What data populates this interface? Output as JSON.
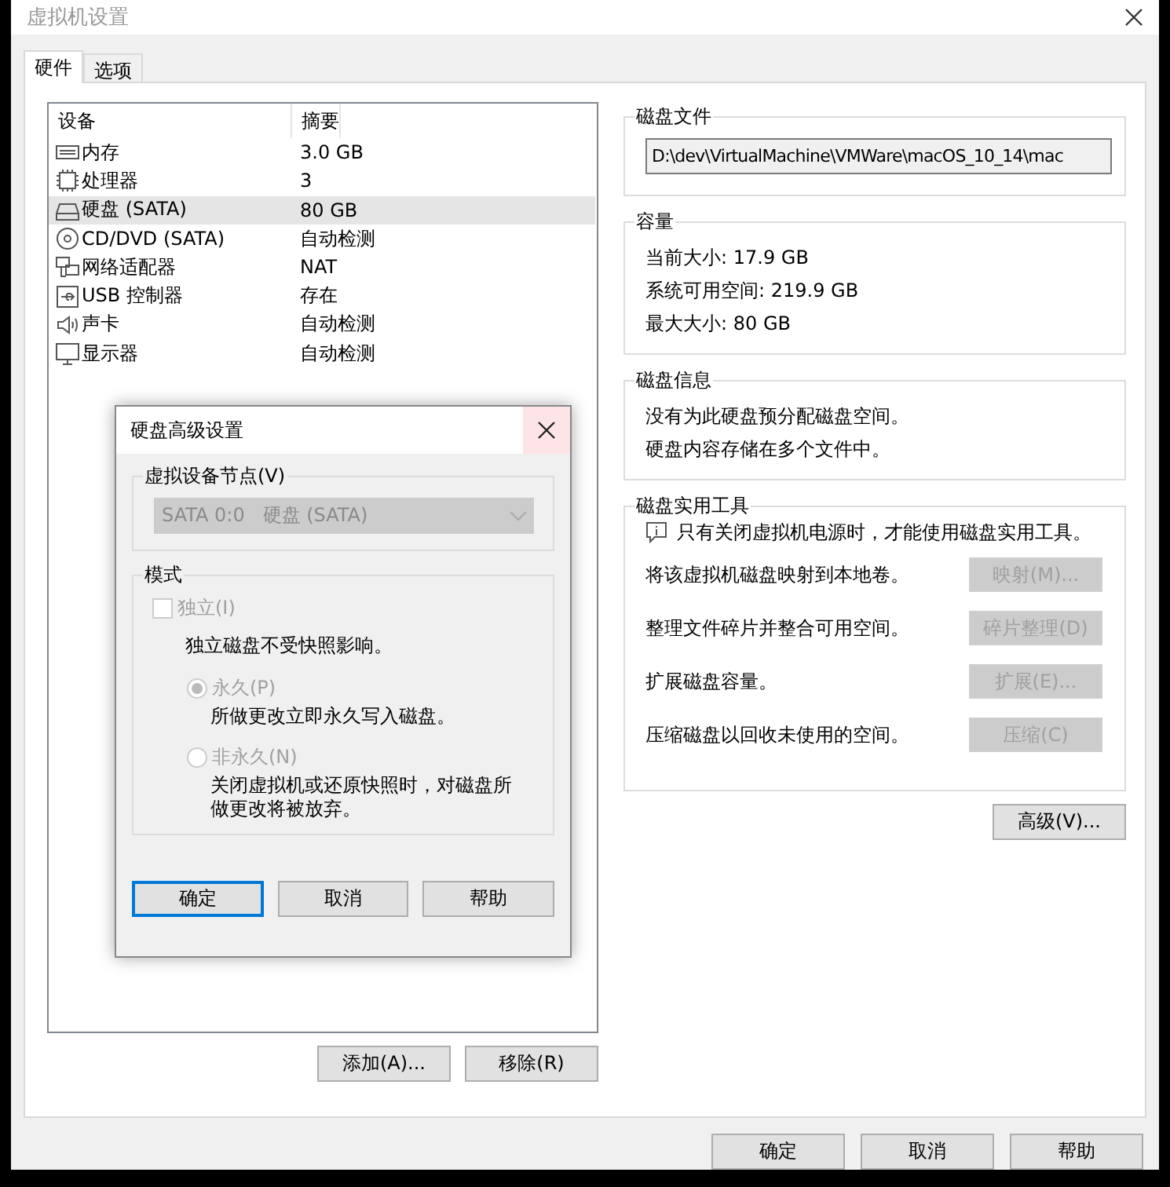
{
  "window": {
    "title": "虚拟机设置"
  },
  "tabs": [
    {
      "label": "硬件",
      "selected": true
    },
    {
      "label": "选项",
      "selected": false
    }
  ],
  "devices": {
    "columns": [
      "设备",
      "摘要"
    ],
    "rows": [
      {
        "kind": "memory",
        "device": "内存",
        "summary": "3.0 GB",
        "selected": false
      },
      {
        "kind": "cpu",
        "device": "处理器",
        "summary": "3",
        "selected": false
      },
      {
        "kind": "disk",
        "device": "硬盘 (SATA)",
        "summary": "80 GB",
        "selected": true
      },
      {
        "kind": "cdrom",
        "device": "CD/DVD (SATA)",
        "summary": "自动检测",
        "selected": false
      },
      {
        "kind": "network",
        "device": "网络适配器",
        "summary": "NAT",
        "selected": false
      },
      {
        "kind": "usb",
        "device": "USB 控制器",
        "summary": "存在",
        "selected": false
      },
      {
        "kind": "sound",
        "device": "声卡",
        "summary": "自动检测",
        "selected": false
      },
      {
        "kind": "display",
        "device": "显示器",
        "summary": "自动检测",
        "selected": false
      }
    ]
  },
  "device_buttons": [
    "添加(A)...",
    "移除(R)"
  ],
  "disk_file": {
    "title": "磁盘文件",
    "value": "D:\\dev\\VirtualMachine\\VMWare\\macOS_10_14\\mac"
  },
  "capacity": {
    "title": "容量",
    "lines": [
      "当前大小: 17.9 GB",
      "系统可用空间: 219.9 GB",
      "最大大小: 80 GB"
    ]
  },
  "disk_info": {
    "title": "磁盘信息",
    "lines": [
      "没有为此硬盘预分配磁盘空间。",
      "硬盘内容存储在多个文件中。"
    ]
  },
  "utilities": {
    "title": "磁盘实用工具",
    "note": "只有关闭虚拟机电源时，才能使用磁盘实用工具。",
    "actions": [
      {
        "description": "将该虚拟机磁盘映射到本地卷。",
        "button": "映射(M)...",
        "disabled": true
      },
      {
        "description": "整理文件碎片并整合可用空间。",
        "button": "碎片整理(D)",
        "disabled": true
      },
      {
        "description": "扩展磁盘容量。",
        "button": "扩展(E)...",
        "disabled": true
      },
      {
        "description": "压缩磁盘以回收未使用的空间。",
        "button": "压缩(C)",
        "disabled": true
      }
    ]
  },
  "advanced_button": "高级(V)...",
  "dialog_buttons": [
    "确定",
    "取消",
    "帮助"
  ],
  "advanced_dialog": {
    "title": "硬盘高级设置",
    "node_group": {
      "title": "虚拟设备节点(V)",
      "dropdown": {
        "value": "SATA 0:0   硬盘 (SATA)",
        "disabled": true
      }
    },
    "mode_group": {
      "title": "模式",
      "independent": {
        "label": "独立(I)",
        "checked": false,
        "disabled": true
      },
      "independent_note": "独立磁盘不受快照影响。",
      "options": [
        {
          "label": "永久(P)",
          "description": "所做更改立即永久写入磁盘。",
          "selected": true,
          "disabled": true
        },
        {
          "label": "非永久(N)",
          "description": "关闭虚拟机或还原快照时，对磁盘所做更改将被放弃。",
          "selected": false,
          "disabled": true
        }
      ]
    },
    "buttons": [
      {
        "label": "确定",
        "focused": true
      },
      {
        "label": "取消",
        "focused": false
      },
      {
        "label": "帮助",
        "focused": false
      }
    ]
  }
}
